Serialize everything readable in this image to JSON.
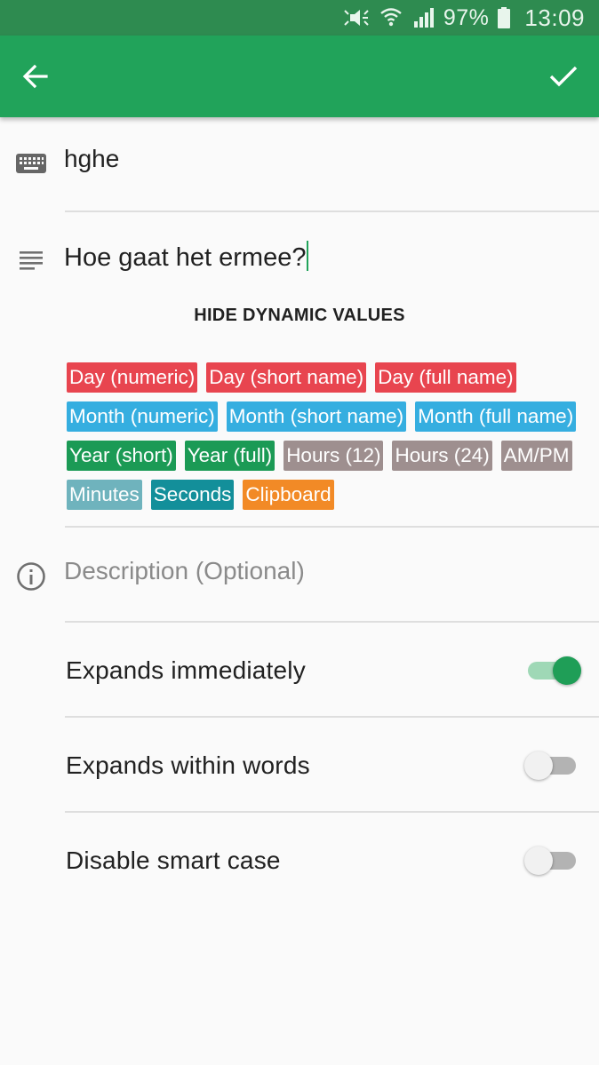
{
  "status_bar": {
    "battery_percent": "97%",
    "time": "13:09",
    "icons": [
      "mute-icon",
      "wifi-icon",
      "signal-icon",
      "battery-icon"
    ]
  },
  "app_bar": {
    "back_icon": "arrow-back-icon",
    "save_icon": "check-icon",
    "background_color": "#21a35a"
  },
  "abbreviation": {
    "value": "hghe",
    "icon": "keyboard-icon"
  },
  "phrase": {
    "value": "Hoe gaat het ermee?",
    "icon": "text-lines-icon"
  },
  "dynamic_values": {
    "toggle_label": "HIDE DYNAMIC VALUES",
    "chips": [
      {
        "label": "Day (numeric)",
        "color": "#e8454f"
      },
      {
        "label": "Day (short name)",
        "color": "#e8454f"
      },
      {
        "label": "Day (full name)",
        "color": "#e8454f"
      },
      {
        "label": "Month (numeric)",
        "color": "#35aee0"
      },
      {
        "label": "Month (short name)",
        "color": "#35aee0"
      },
      {
        "label": "Month (full name)",
        "color": "#35aee0"
      },
      {
        "label": "Year (short)",
        "color": "#1b9a55"
      },
      {
        "label": "Year (full)",
        "color": "#1b9a55"
      },
      {
        "label": "Hours (12)",
        "color": "#9e8f8f"
      },
      {
        "label": "Hours (24)",
        "color": "#9e8f8f"
      },
      {
        "label": "AM/PM",
        "color": "#9e8f8f"
      },
      {
        "label": "Minutes",
        "color": "#6fb3bd"
      },
      {
        "label": "Seconds",
        "color": "#138f9a"
      },
      {
        "label": "Clipboard",
        "color": "#f28a26"
      }
    ]
  },
  "description": {
    "placeholder": "Description (Optional)",
    "value": "",
    "icon": "info-icon"
  },
  "options": [
    {
      "label": "Expands immediately",
      "enabled": true
    },
    {
      "label": "Expands within words",
      "enabled": false
    },
    {
      "label": "Disable smart case",
      "enabled": false
    }
  ]
}
